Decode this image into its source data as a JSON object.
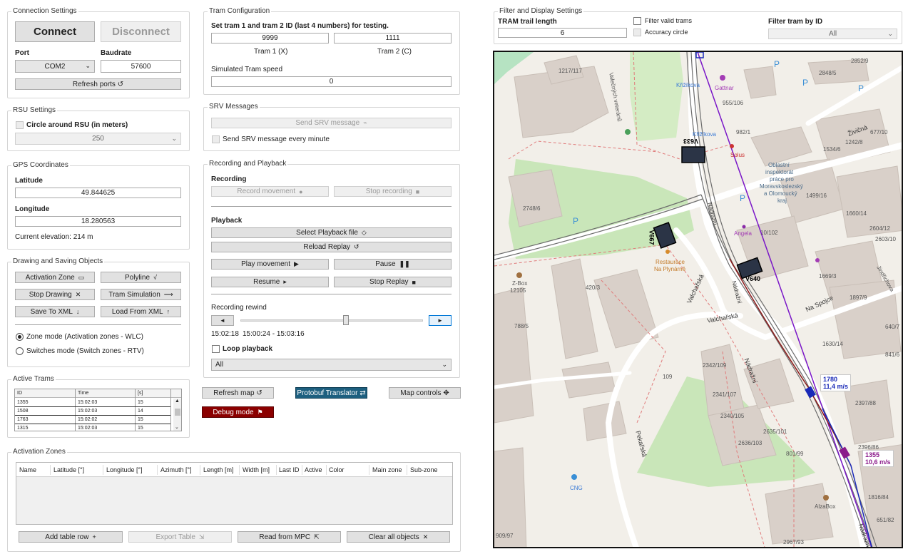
{
  "connection": {
    "title": "Connection Settings",
    "connect": "Connect",
    "disconnect": "Disconnect",
    "port_label": "Port",
    "port_value": "COM2",
    "baud_label": "Baudrate",
    "baud_value": "57600",
    "refresh": "Refresh ports ↺"
  },
  "rsu": {
    "title": "RSU Settings",
    "circle_label": "Circle around RSU (in meters)",
    "radius": "250"
  },
  "gps": {
    "title": "GPS Coordinates",
    "lat_label": "Latitude",
    "lat_value": "49.844625",
    "lon_label": "Longitude",
    "lon_value": "18.280563",
    "elevation": "Current elevation: 214 m"
  },
  "drawing": {
    "title": "Drawing and Saving Objects",
    "activation_zone": "Activation Zone",
    "polyline": "Polyline",
    "stop_drawing": "Stop Drawing",
    "tram_simulation": "Tram Simulation",
    "save_xml": "Save To XML",
    "load_xml": "Load From XML",
    "zone_mode": "Zone mode (Activation zones - WLC)",
    "switches_mode": "Switches mode (Switch zones - RTV)"
  },
  "active_trams": {
    "title": "Active Trams",
    "headers": [
      "ID",
      "Time",
      "[s]"
    ],
    "rows": [
      [
        "1355",
        "15:02:03",
        "15"
      ],
      [
        "1508",
        "15:02:03",
        "14"
      ],
      [
        "1763",
        "15:02:02",
        "15"
      ],
      [
        "1315",
        "15:02:03",
        "15"
      ]
    ]
  },
  "tram_config": {
    "title": "Tram Configuration",
    "instruction": "Set tram 1 and tram 2 ID (last 4 numbers) for testing.",
    "tram1_value": "9999",
    "tram2_value": "1111",
    "tram1_label": "Tram 1 (X)",
    "tram2_label": "Tram 2 (C)",
    "speed_label": "Simulated Tram speed",
    "speed_value": "0"
  },
  "srv": {
    "title": "SRV Messages",
    "send": "Send SRV message",
    "every_minute": "Send SRV message every minute"
  },
  "recording": {
    "title": "Recording and Playback",
    "recording_label": "Recording",
    "record_movement": "Record movement",
    "stop_recording": "Stop recording",
    "playback_label": "Playback",
    "select_file": "Select Playback file",
    "reload": "Reload Replay",
    "play": "Play movement",
    "pause": "Pause",
    "resume": "Resume",
    "stop_replay": "Stop Replay",
    "rewind_label": "Recording rewind",
    "rewind_left": "◄",
    "rewind_right": "►",
    "rewind_position": 0.58,
    "time_current": "15:02:18",
    "time_range": "15:00:24 - 15:03:16",
    "loop": "Loop playback",
    "filter_value": "All"
  },
  "middle_buttons": {
    "refresh_map": "Refresh map ↺",
    "protobuf": "Protobuf Translator ⇄",
    "map_controls": "Map controls ✥",
    "debug": "Debug mode"
  },
  "activation_zones": {
    "title": "Activation Zones",
    "headers": [
      "Name",
      "Latitude [°]",
      "Longitude [°]",
      "Azimuth [°]",
      "Length [m]",
      "Width [m]",
      "Last ID",
      "Active",
      "Color",
      "Main zone",
      "Sub-zone"
    ],
    "add_row": "Add table row",
    "export": "Export Table",
    "read_mpc": "Read from MPC",
    "clear": "Clear all objects"
  },
  "filter": {
    "title": "Filter and Display Settings",
    "trail_label": "TRAM trail length",
    "trail_value": "6",
    "valid_trams": "Filter valid trams",
    "accuracy": "Accuracy circle",
    "id_label": "Filter tram by ID",
    "id_value": "All"
  },
  "map": {
    "labels": [
      "1217/117",
      "Valečných veteránů",
      "Křižíkova",
      "Gattnar",
      "2848/5",
      "2852/9",
      "955/106",
      "982/1",
      "Křižíkova",
      "Solus",
      "Živičná",
      "1534/6",
      "1242/8",
      "677/10",
      "Oblastní",
      "inspektorát",
      "práce pro",
      "Moravskoslezský",
      "a Olomoucký",
      "kraj",
      "1499/16",
      "1660/14",
      "2604/12",
      "2603/10",
      "2748/6",
      "Nádražní",
      "Angela",
      "10/102",
      "Restaurace",
      "Na Plynárně",
      "Z-Box",
      "12105",
      "420/3",
      "1669/3",
      "Na Spojce",
      "1897/9",
      "Jindřichova",
      "788/5",
      "Valchařská",
      "Nádražní",
      "Valchařská",
      "640/7",
      "1630/14",
      "841/6",
      "109",
      "2342/109",
      "2341/107",
      "2340/105",
      "2636/103",
      "2635/101",
      "801/99",
      "2397/88",
      "2396/86",
      "Pekařská",
      "CNG",
      "AlzaBox",
      "2967/93",
      "1816/84",
      "651/82",
      "909/97",
      "Nádražní",
      "Nádražní"
    ],
    "trams": [
      {
        "id": "V633"
      },
      {
        "id": "V667"
      },
      {
        "id": "V640"
      }
    ],
    "tram_1780": {
      "id": "1780",
      "speed": "11,4 m/s"
    },
    "tram_1355": {
      "id": "1355",
      "speed": "10,6 m/s"
    }
  }
}
